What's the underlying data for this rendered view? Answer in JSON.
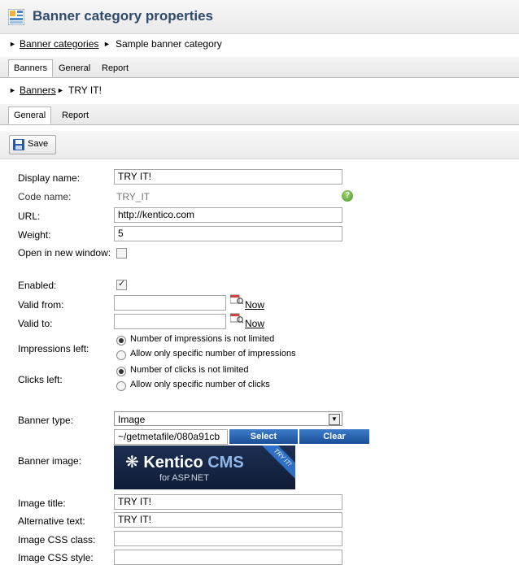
{
  "header": {
    "title": "Banner category properties"
  },
  "breadcrumb1": {
    "link": "Banner categories",
    "current": "Sample banner category"
  },
  "tabs1": [
    "Banners",
    "General",
    "Report"
  ],
  "breadcrumb2": {
    "link": "Banners",
    "current": "TRY IT!"
  },
  "tabs2": [
    "General",
    "Report"
  ],
  "toolbar": {
    "save_label": "Save"
  },
  "form": {
    "display_name": {
      "label": "Display name:",
      "value": "TRY IT!"
    },
    "code_name": {
      "label": "Code name:",
      "value": "TRY_IT",
      "help": "?"
    },
    "url": {
      "label": "URL:",
      "value": "http://kentico.com"
    },
    "weight": {
      "label": "Weight:",
      "value": "5"
    },
    "open_new_window": {
      "label": "Open in new window:",
      "checked": false
    },
    "enabled": {
      "label": "Enabled:",
      "checked": true
    },
    "valid_from": {
      "label": "Valid from:",
      "value": "",
      "now": "Now"
    },
    "valid_to": {
      "label": "Valid to:",
      "value": "",
      "now": "Now"
    },
    "impressions_left": {
      "label": "Impressions left:",
      "options": [
        "Number of impressions is not limited",
        "Allow only specific number of impressions"
      ],
      "selected": 0
    },
    "clicks_left": {
      "label": "Clicks left:",
      "options": [
        "Number of clicks is not limited",
        "Allow only specific number of clicks"
      ],
      "selected": 0
    },
    "banner_type": {
      "label": "Banner type:",
      "value": "Image"
    },
    "banner_image": {
      "label": "Banner image:",
      "path": "~/getmetafile/080a91cb",
      "select": "Select",
      "clear": "Clear",
      "logo_main": "Kentico",
      "logo_cms": "CMS",
      "logo_sub": "for ASP.NET",
      "ribbon": "TRY IT!"
    },
    "image_title": {
      "label": "Image title:",
      "value": "TRY IT!"
    },
    "alt_text": {
      "label": "Alternative text:",
      "value": "TRY IT!"
    },
    "css_class": {
      "label": "Image CSS class:",
      "value": ""
    },
    "css_style": {
      "label": "Image CSS style:",
      "value": ""
    }
  },
  "colors": {
    "title": "#2f4a6b",
    "button_blue": "#1b4f98",
    "help_green": "#4e9a2a"
  }
}
